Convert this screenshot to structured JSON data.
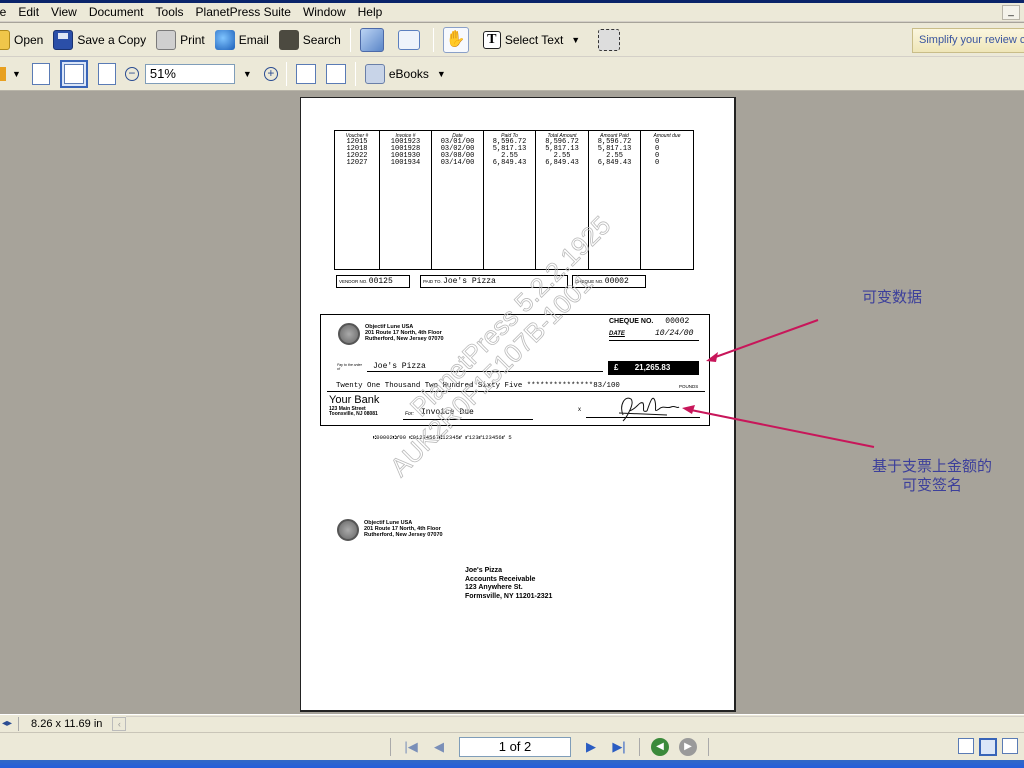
{
  "menu": [
    "le",
    "Edit",
    "View",
    "Document",
    "Tools",
    "PlanetPress Suite",
    "Window",
    "Help"
  ],
  "toolbar1": {
    "open": "Open",
    "save_copy": "Save a Copy",
    "print": "Print",
    "email": "Email",
    "search": "Search",
    "select_text": "Select Text",
    "simplify": "Simplify your review c"
  },
  "toolbar2": {
    "zoom": "51%",
    "ebooks": "eBooks"
  },
  "document": {
    "table_headers": [
      "Voucher #",
      "Invoice #",
      "Date",
      "Paid To",
      "Total Amount",
      "Amount Paid",
      "Amount due"
    ],
    "rows": [
      [
        "12015",
        "1001923",
        "03/01/00",
        "8,596.72",
        "8,596.72",
        "8,596.72",
        "0"
      ],
      [
        "12018",
        "1001928",
        "03/02/00",
        "5,817.13",
        "5,817.13",
        "5,817.13",
        "0"
      ],
      [
        "12022",
        "1001930",
        "03/08/00",
        "2.55",
        "2.55",
        "2.55",
        "0"
      ],
      [
        "12027",
        "1001934",
        "03/14/00",
        "6,849.43",
        "6,849.43",
        "6,849.43",
        "0"
      ]
    ],
    "vendor_label": "VENDOR NO.",
    "vendor_no": "00125",
    "paid_to_label": "PAID TO.",
    "paid_to": "Joe's Pizza",
    "cheque_label_small": "CHEQUE NO.",
    "cheque_no_small": "00002",
    "company_name": "Objectif Lune USA",
    "company_addr1": "201 Route 17 North, 4th Floor",
    "company_addr2": "Rutherford, New Jersey 07070",
    "cheque_no_label": "CHEQUE NO.",
    "cheque_no": "00002",
    "date_label": "DATE",
    "date": "10/24/00",
    "pay_order_label": "Pay to the order of",
    "payee": "Joe's Pizza",
    "currency": "£",
    "amount": "21,265.83",
    "amount_words": "Twenty One Thousand Two Hundred Sixty Five ***************83/100",
    "pounds": "POUNDS",
    "bank_name": "Your Bank",
    "bank_addr1": "123 Main Street",
    "bank_addr2": "Toonsville, NJ 08081",
    "for_label": "For:",
    "for_text": "Invoice Due",
    "micr": "⑆00002⑆⑈00   ⑆01234567⑆12345⑈   ⑈123⑈123456⑈ 5",
    "recipient_name": "Joe's Pizza",
    "recipient_dept": "Accounts Receivable",
    "recipient_addr1": "123 Anywhere St.",
    "recipient_addr2": "Formsville, NY  11201-2321"
  },
  "annotations": {
    "variable_data": "可变数据",
    "variable_signature_1": "基于支票上金额的",
    "variable_signature_2": "可变签名",
    "arrow_color": "#c8165a"
  },
  "status": {
    "page_size": "8.26 x 11.69 in",
    "page_indicator": "1 of 2"
  }
}
